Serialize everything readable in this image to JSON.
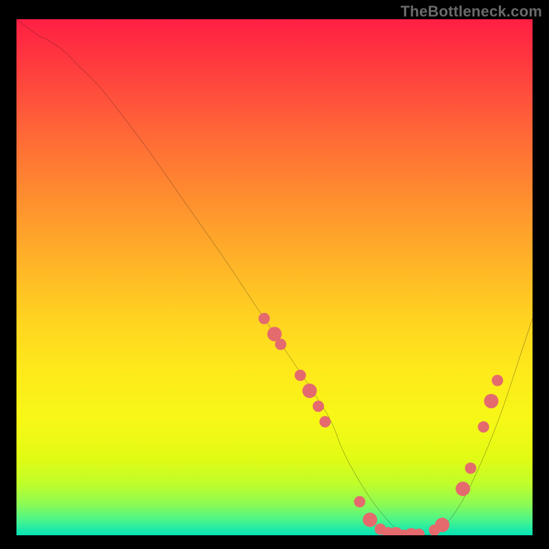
{
  "watermark": "TheBottleneck.com",
  "chart_data": {
    "type": "line",
    "title": "",
    "xlabel": "",
    "ylabel": "",
    "xlim": [
      0,
      100
    ],
    "ylim": [
      0,
      100
    ],
    "series": [
      {
        "name": "curve",
        "x": [
          0,
          4,
          6,
          9,
          12,
          16,
          20,
          26,
          33,
          40,
          46,
          50,
          54,
          58,
          61,
          63,
          65,
          68,
          71,
          74,
          78,
          82,
          86,
          90,
          94,
          98,
          100
        ],
        "y": [
          100,
          97,
          96,
          94,
          91,
          87,
          82,
          74,
          64,
          54,
          45,
          39,
          33,
          27,
          22,
          17,
          13,
          8,
          4,
          1,
          0,
          1,
          6,
          14,
          24,
          36,
          42
        ]
      }
    ],
    "markers": [
      {
        "x": 48,
        "y": 42,
        "r": 1.1
      },
      {
        "x": 50,
        "y": 39,
        "r": 1.4
      },
      {
        "x": 51.2,
        "y": 37,
        "r": 1.1
      },
      {
        "x": 55,
        "y": 31,
        "r": 1.1
      },
      {
        "x": 56.8,
        "y": 28,
        "r": 1.4
      },
      {
        "x": 58.5,
        "y": 25,
        "r": 1.1
      },
      {
        "x": 59.8,
        "y": 22,
        "r": 1.1
      },
      {
        "x": 66.5,
        "y": 6.5,
        "r": 1.1
      },
      {
        "x": 68.5,
        "y": 3,
        "r": 1.4
      },
      {
        "x": 70.5,
        "y": 1.2,
        "r": 1.1
      },
      {
        "x": 72,
        "y": 0.5,
        "r": 1.1
      },
      {
        "x": 73.5,
        "y": 0.2,
        "r": 1.4
      },
      {
        "x": 75,
        "y": 0,
        "r": 1.1
      },
      {
        "x": 76.5,
        "y": 0,
        "r": 1.4
      },
      {
        "x": 78,
        "y": 0.2,
        "r": 1.1
      },
      {
        "x": 81,
        "y": 1,
        "r": 1.1
      },
      {
        "x": 82.5,
        "y": 2,
        "r": 1.4
      },
      {
        "x": 86.5,
        "y": 9,
        "r": 1.4
      },
      {
        "x": 88,
        "y": 13,
        "r": 1.1
      },
      {
        "x": 90.5,
        "y": 21,
        "r": 1.1
      },
      {
        "x": 92,
        "y": 26,
        "r": 1.4
      },
      {
        "x": 93.2,
        "y": 30,
        "r": 1.1
      }
    ],
    "marker_color": "#e46a6e",
    "curve_color": "#151515",
    "curve_width": 2.4
  }
}
